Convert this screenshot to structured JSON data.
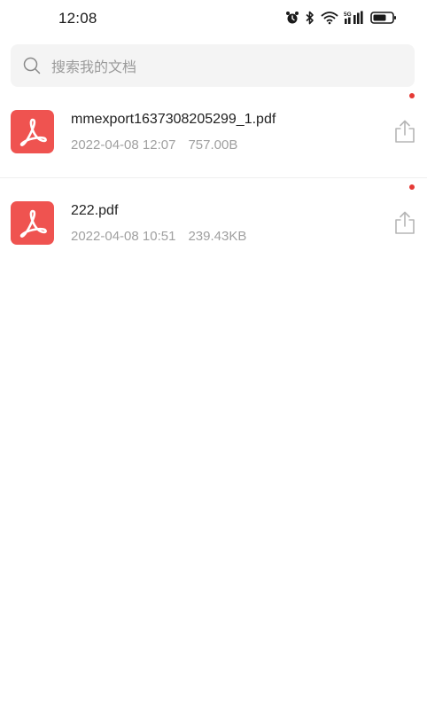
{
  "status_bar": {
    "time": "12:08",
    "icons": [
      "alarm-icon",
      "bluetooth-icon",
      "wifi-icon",
      "5g-signal-icon",
      "battery-icon"
    ],
    "network_label": "5G"
  },
  "search": {
    "placeholder": "搜索我的文档"
  },
  "files": [
    {
      "name": "mmexport1637308205299_1.pdf",
      "date": "2022-04-08 12:07",
      "size": "757.00B",
      "unread": true
    },
    {
      "name": "222.pdf",
      "date": "2022-04-08 10:51",
      "size": "239.43KB",
      "unread": true
    }
  ],
  "colors": {
    "pdf_icon_bg": "#ef5350",
    "unread_dot": "#e53935",
    "meta_text": "#a0a0a0",
    "search_bg": "#f4f4f4"
  }
}
